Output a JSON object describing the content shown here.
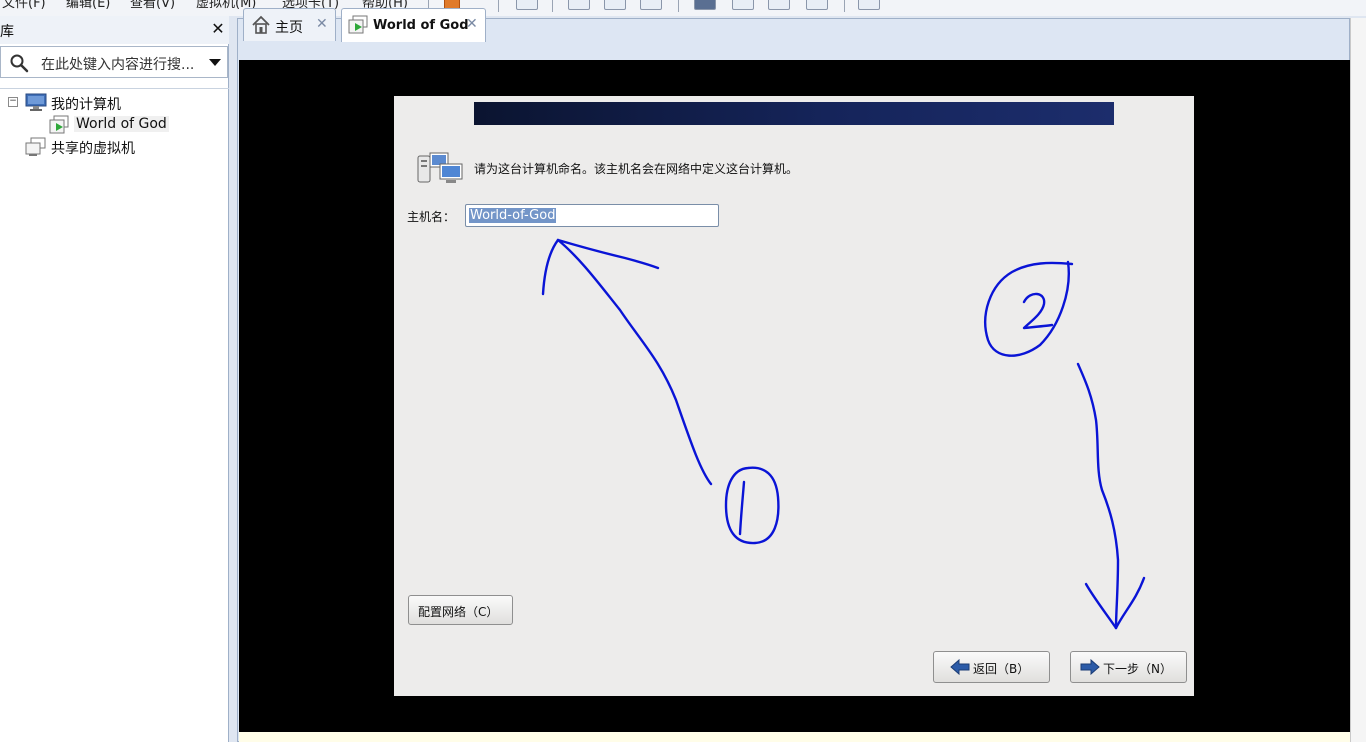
{
  "menubar": {
    "items": [
      "文件(F)",
      "编辑(E)",
      "查看(V)",
      "虚拟机(M)",
      "选项卡(T)",
      "帮助(H)"
    ]
  },
  "library": {
    "title": "库",
    "close_glyph": "✕",
    "search_placeholder": "在此处键入内容进行搜...",
    "tree": {
      "my_computer": "我的计算机",
      "vm": "World of God",
      "shared": "共享的虚拟机",
      "toggle": "⊟"
    }
  },
  "tabs": [
    {
      "label": "主页",
      "icon": "home-icon",
      "active": false
    },
    {
      "label": "World of God",
      "icon": "vm-icon",
      "active": true
    }
  ],
  "tab_close_glyph": "✕",
  "installer": {
    "prompt": "请为这台计算机命名。该主机名会在网络中定义这台计算机。",
    "hostname_label": "主机名：",
    "hostname_value": "World-of-God",
    "configure_network": "配置网络（C）",
    "back": "返回（B）",
    "next": "下一步（N）"
  },
  "annotations": {
    "circle_1": "1",
    "circle_2": "2"
  },
  "colors": {
    "annotation": "#0a14d6",
    "banner": "#15245a",
    "selection": "#7395c8"
  }
}
